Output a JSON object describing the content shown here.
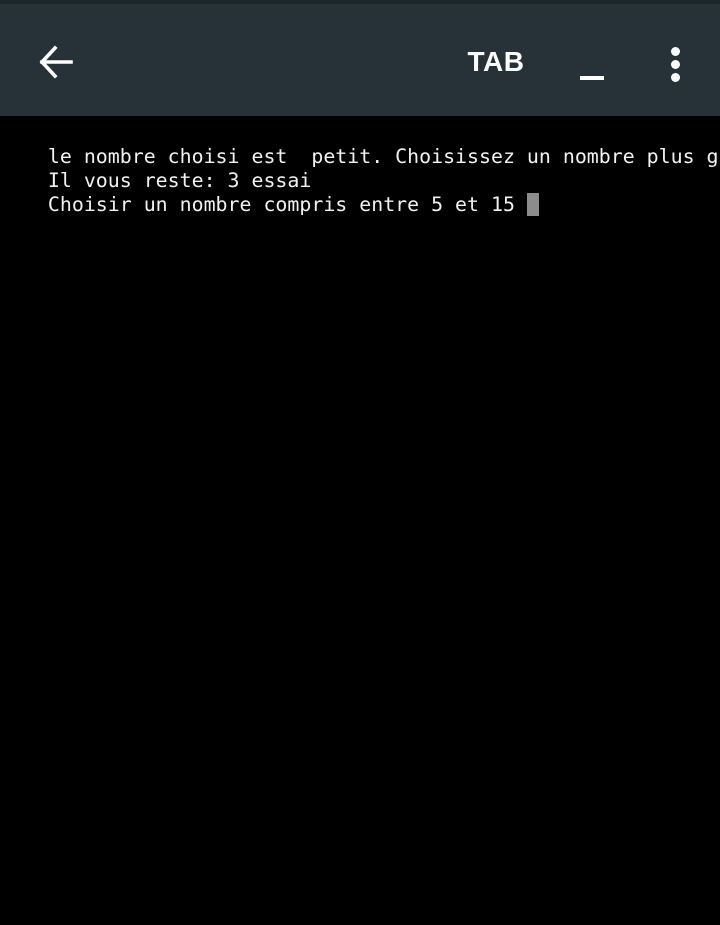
{
  "app_bar": {
    "back_icon": "arrow-left-icon",
    "tab_label": "TAB",
    "underscore_label": "_",
    "menu_icon": "more-vert-icon",
    "background_color": "#263238",
    "foreground_color": "#ffffff"
  },
  "terminal": {
    "lines": [
      "le nombre choisi est  petit. Choisissez un nombre plus grand",
      "Il vous reste: 3 essai",
      "Choisir un nombre compris entre 5 et 15 "
    ],
    "background_color": "#000000",
    "text_color": "#f2f2f2",
    "cursor_color": "#8c8c8c"
  }
}
